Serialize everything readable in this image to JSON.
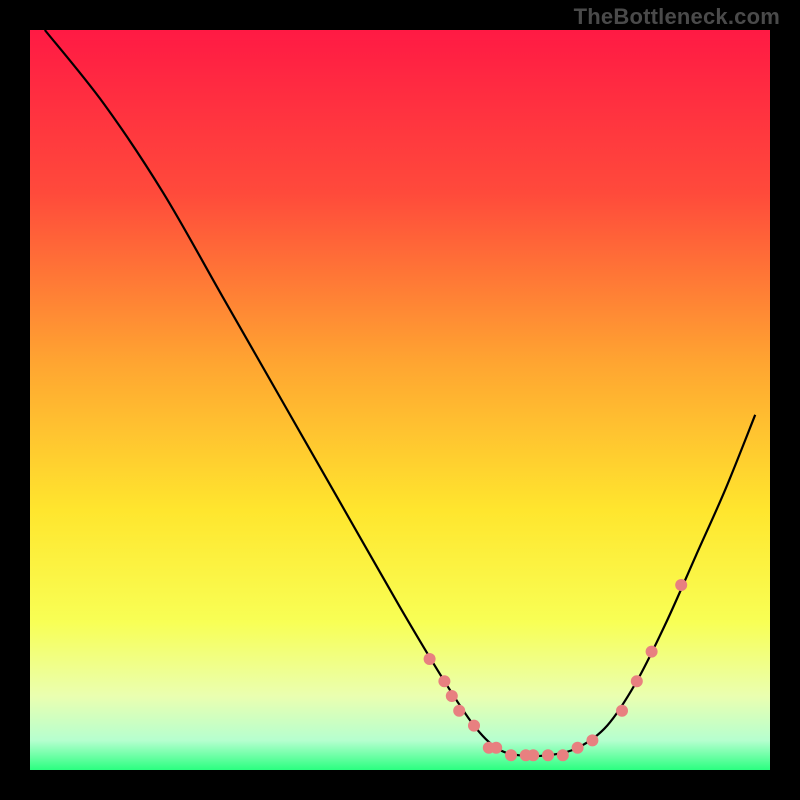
{
  "attribution": "TheBottleneck.com",
  "chart_data": {
    "type": "line",
    "title": "",
    "xlabel": "",
    "ylabel": "",
    "xlim": [
      0,
      100
    ],
    "ylim": [
      0,
      100
    ],
    "axes_visible": false,
    "background_gradient": {
      "stops": [
        {
          "offset": 0.0,
          "color": "#ff1a44"
        },
        {
          "offset": 0.22,
          "color": "#ff4a3b"
        },
        {
          "offset": 0.45,
          "color": "#ffa531"
        },
        {
          "offset": 0.65,
          "color": "#ffe62e"
        },
        {
          "offset": 0.8,
          "color": "#f8ff55"
        },
        {
          "offset": 0.9,
          "color": "#eaffb0"
        },
        {
          "offset": 0.96,
          "color": "#b6ffcf"
        },
        {
          "offset": 1.0,
          "color": "#2bff80"
        }
      ]
    },
    "series": [
      {
        "name": "bottleneck-curve",
        "color": "#000000",
        "x": [
          2,
          10,
          18,
          26,
          34,
          42,
          50,
          56,
          60,
          63,
          66,
          70,
          74,
          78,
          82,
          86,
          90,
          94,
          98
        ],
        "y": [
          100,
          90,
          78,
          64,
          50,
          36,
          22,
          12,
          6,
          3,
          2,
          2,
          3,
          6,
          12,
          20,
          29,
          38,
          48
        ]
      }
    ],
    "markers": {
      "name": "highlight-points",
      "color": "#e88080",
      "points": [
        {
          "x": 54,
          "y": 15
        },
        {
          "x": 56,
          "y": 12
        },
        {
          "x": 57,
          "y": 10
        },
        {
          "x": 58,
          "y": 8
        },
        {
          "x": 60,
          "y": 6
        },
        {
          "x": 62,
          "y": 3
        },
        {
          "x": 63,
          "y": 3
        },
        {
          "x": 65,
          "y": 2
        },
        {
          "x": 67,
          "y": 2
        },
        {
          "x": 68,
          "y": 2
        },
        {
          "x": 70,
          "y": 2
        },
        {
          "x": 72,
          "y": 2
        },
        {
          "x": 74,
          "y": 3
        },
        {
          "x": 76,
          "y": 4
        },
        {
          "x": 80,
          "y": 8
        },
        {
          "x": 82,
          "y": 12
        },
        {
          "x": 84,
          "y": 16
        },
        {
          "x": 88,
          "y": 25
        }
      ]
    }
  }
}
